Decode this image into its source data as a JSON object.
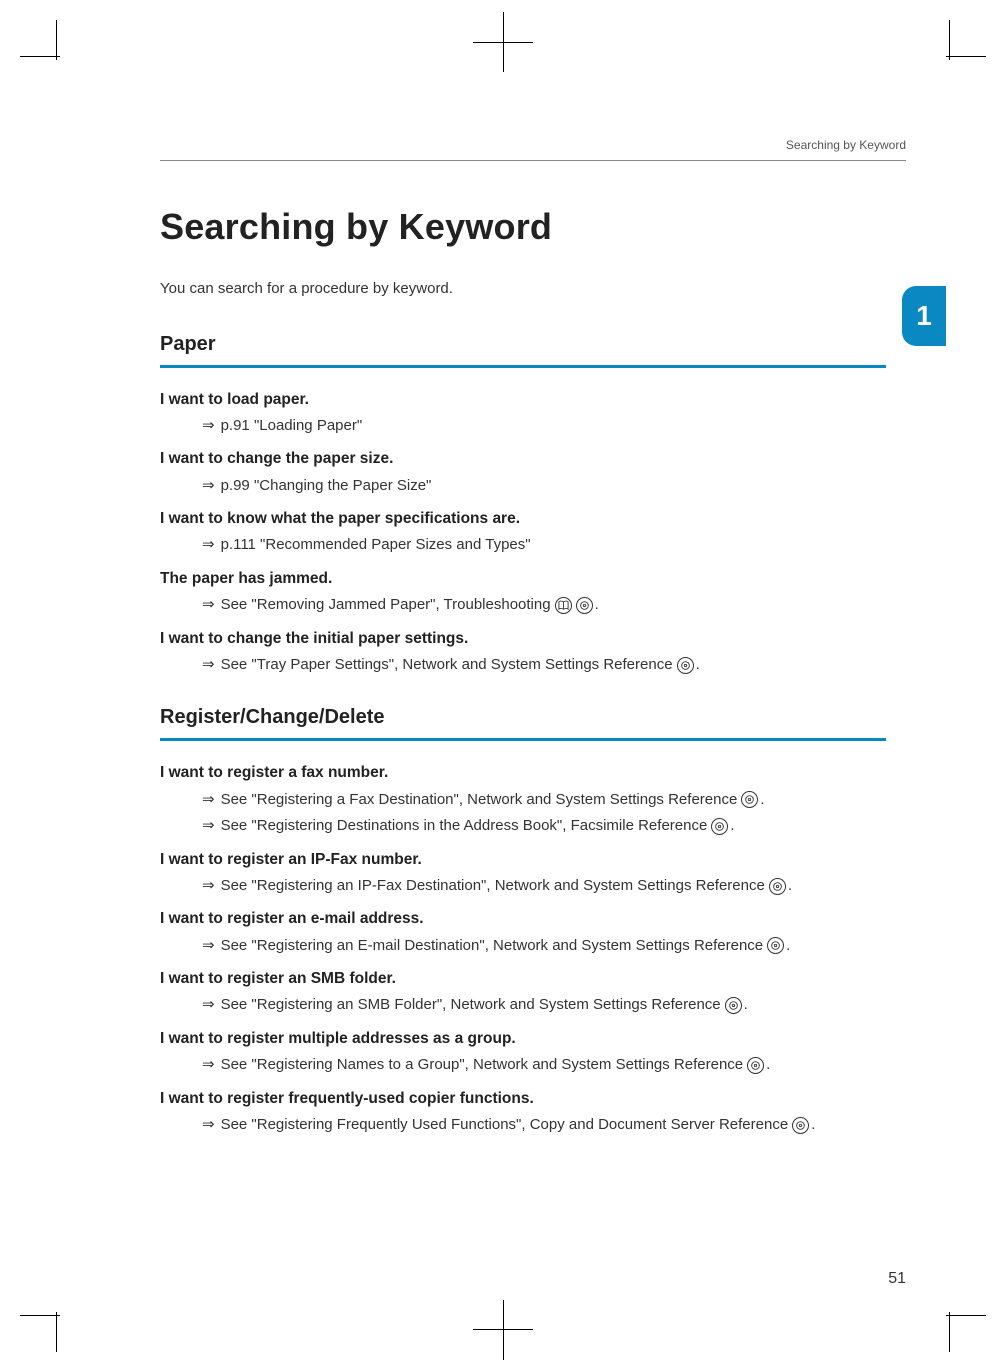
{
  "running_head": "Searching by Keyword",
  "chapter_tab": "1",
  "title": "Searching by Keyword",
  "intro": "You can search for a procedure by keyword.",
  "sections": [
    {
      "heading": "Paper",
      "topics": [
        {
          "label": "I want to load paper.",
          "refs": [
            {
              "arrow": "⇒",
              "text": "p.91 \"Loading Paper\"",
              "icons": []
            }
          ]
        },
        {
          "label": "I want to change the paper size.",
          "refs": [
            {
              "arrow": "⇒",
              "text": "p.99 \"Changing the Paper Size\"",
              "icons": []
            }
          ]
        },
        {
          "label": "I want to know what the paper specifications are.",
          "refs": [
            {
              "arrow": "⇒",
              "text": "p.111 \"Recommended Paper Sizes and Types\"",
              "icons": []
            }
          ]
        },
        {
          "label": "The paper has jammed.",
          "refs": [
            {
              "arrow": "⇒",
              "text": "See \"Removing Jammed Paper\", Troubleshooting",
              "icons": [
                "book",
                "cd"
              ],
              "suffix": "."
            }
          ]
        },
        {
          "label": "I want to change the initial paper settings.",
          "refs": [
            {
              "arrow": "⇒",
              "text": "See \"Tray Paper Settings\", Network and System Settings Reference",
              "icons": [
                "cd"
              ],
              "suffix": "."
            }
          ]
        }
      ]
    },
    {
      "heading": "Register/Change/Delete",
      "topics": [
        {
          "label": "I want to register a fax number.",
          "refs": [
            {
              "arrow": "⇒",
              "text": "See \"Registering a Fax Destination\", Network and System Settings Reference",
              "icons": [
                "cd"
              ],
              "suffix": "."
            },
            {
              "arrow": "⇒",
              "text": "See \"Registering Destinations in the Address Book\", Facsimile Reference",
              "icons": [
                "cd"
              ],
              "suffix": "."
            }
          ]
        },
        {
          "label": "I want to register an IP-Fax number.",
          "refs": [
            {
              "arrow": "⇒",
              "text": "See \"Registering an IP-Fax Destination\", Network and System Settings Reference",
              "icons": [
                "cd"
              ],
              "suffix": "."
            }
          ]
        },
        {
          "label": "I want to register an e-mail address.",
          "refs": [
            {
              "arrow": "⇒",
              "text": "See \"Registering an E-mail Destination\", Network and System Settings Reference",
              "icons": [
                "cd"
              ],
              "suffix": "."
            }
          ]
        },
        {
          "label": "I want to register an SMB folder.",
          "refs": [
            {
              "arrow": "⇒",
              "text": "See \"Registering an SMB Folder\", Network and System Settings Reference",
              "icons": [
                "cd"
              ],
              "suffix": "."
            }
          ]
        },
        {
          "label": "I want to register multiple addresses as a group.",
          "refs": [
            {
              "arrow": "⇒",
              "text": "See \"Registering Names to a Group\", Network and System Settings Reference",
              "icons": [
                "cd"
              ],
              "suffix": "."
            }
          ]
        },
        {
          "label": "I want to register frequently-used copier functions.",
          "refs": [
            {
              "arrow": "⇒",
              "text": "See \"Registering Frequently Used Functions\", Copy and Document Server Reference",
              "icons": [
                "cd"
              ],
              "suffix": "."
            }
          ]
        }
      ]
    }
  ],
  "page_number": "51"
}
